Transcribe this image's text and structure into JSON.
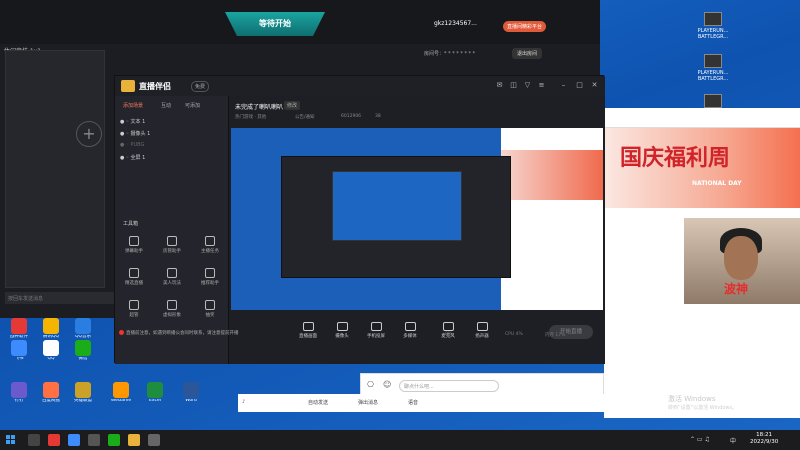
{
  "back_window": {
    "start_tab": "等待开始",
    "left_title": "休闲竞技·1v1",
    "username": "gkz1234567...",
    "join_btn": "直播间精彩平台",
    "room_label": "房间号：",
    "room_value": "* * * * * * * *",
    "exit_btn": "退出房间",
    "chat_placeholder": "按回车发送消息"
  },
  "main_window": {
    "app_name": "直播伴侣",
    "badge": "免费",
    "side_tabs": [
      "添加场景",
      "互动",
      "可添加"
    ],
    "scenes": [
      "文本 1",
      "摄像头 1",
      "PUBG",
      "全屏 1"
    ],
    "tools_title": "工具箱",
    "tools": [
      "弹幕助手",
      "房管助手",
      "主播任务",
      "精选直播",
      "美人玩法",
      "推荐助手",
      "超管",
      "虚拟形象",
      "抽奖"
    ],
    "live_title": "未完成了喇叭喇叭",
    "live_chip": "修改",
    "live_meta": [
      "热门游戏 · 其他",
      "公告/通知",
      "6012906",
      "38"
    ],
    "bottom_buttons": [
      "直播画面",
      "摄像头",
      "手机投屏",
      "多媒体",
      "麦克风",
      "扬声器"
    ],
    "golive": "开始直播",
    "notice": "直播前注意，如遇到断播公会同时联系，请注意提前开播",
    "status": [
      "0%",
      "CPU 4%",
      "内存 17%"
    ]
  },
  "right_panel": {
    "banner_text": "国庆福利周",
    "banner_sub": "NATIONAL DAY",
    "cam_name": "波神",
    "watermark": "激活 Windows",
    "watermark_sub": "转到“设置”以激活 Windows。"
  },
  "chat_bar": {
    "placeholder": "聊点什么吧...",
    "tools": [
      "自动发送",
      "弹出消息",
      "语音"
    ]
  },
  "desktop_icons_right": [
    {
      "label": "PLAYERUN...\nBATTLEGR..."
    },
    {
      "label": "PLAYERUN...\nBATTLEGR..."
    },
    {
      "label": ""
    }
  ],
  "desktop_icons_left": [
    "战神软件",
    "腾讯QQ",
    "QQ音乐",
    "飞书",
    "QQ",
    "微信",
    "钉钉",
    "百度网盘",
    "英雄联盟",
    "WeGame",
    "Excel",
    "Word"
  ],
  "taskbar": {
    "time": "18:21",
    "date": "2022/9/30",
    "ime": "中"
  },
  "colors": {
    "accent": "#1aa4a0",
    "live_red": "#e62d2d",
    "desktop_blue": "#1b5fb8"
  }
}
